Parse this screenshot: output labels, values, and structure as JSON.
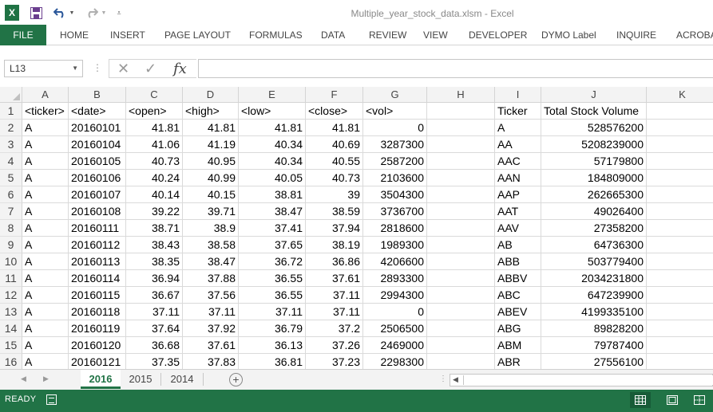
{
  "app": {
    "title": "Multiple_year_stock_data.xlsm - Excel",
    "logo_text": "X"
  },
  "ribbon": {
    "tabs": [
      "FILE",
      "HOME",
      "INSERT",
      "PAGE LAYOUT",
      "FORMULAS",
      "DATA",
      "REVIEW",
      "VIEW",
      "DEVELOPER",
      "DYMO Label",
      "INQUIRE",
      "ACROBA"
    ]
  },
  "formula_bar": {
    "name_box": "L13",
    "cancel_icon": "✕",
    "enter_icon": "✓",
    "fx_label": "fx",
    "content": ""
  },
  "grid": {
    "columns": [
      "A",
      "B",
      "C",
      "D",
      "E",
      "F",
      "G",
      "H",
      "I",
      "J",
      "K"
    ],
    "row_numbers": [
      "1",
      "2",
      "3",
      "4",
      "5",
      "6",
      "7",
      "8",
      "9",
      "10",
      "11",
      "12",
      "13",
      "14",
      "15",
      "16"
    ],
    "rows": [
      [
        "<ticker>",
        "<date>",
        "<open>",
        "<high>",
        "<low>",
        "<close>",
        "<vol>",
        "",
        "Ticker",
        "Total Stock Volume",
        ""
      ],
      [
        "A",
        "20160101",
        "41.81",
        "41.81",
        "41.81",
        "41.81",
        "0",
        "",
        "A",
        "528576200",
        ""
      ],
      [
        "A",
        "20160104",
        "41.06",
        "41.19",
        "40.34",
        "40.69",
        "3287300",
        "",
        "AA",
        "5208239000",
        ""
      ],
      [
        "A",
        "20160105",
        "40.73",
        "40.95",
        "40.34",
        "40.55",
        "2587200",
        "",
        "AAC",
        "57179800",
        ""
      ],
      [
        "A",
        "20160106",
        "40.24",
        "40.99",
        "40.05",
        "40.73",
        "2103600",
        "",
        "AAN",
        "184809000",
        ""
      ],
      [
        "A",
        "20160107",
        "40.14",
        "40.15",
        "38.81",
        "39",
        "3504300",
        "",
        "AAP",
        "262665300",
        ""
      ],
      [
        "A",
        "20160108",
        "39.22",
        "39.71",
        "38.47",
        "38.59",
        "3736700",
        "",
        "AAT",
        "49026400",
        ""
      ],
      [
        "A",
        "20160111",
        "38.71",
        "38.9",
        "37.41",
        "37.94",
        "2818600",
        "",
        "AAV",
        "27358200",
        ""
      ],
      [
        "A",
        "20160112",
        "38.43",
        "38.58",
        "37.65",
        "38.19",
        "1989300",
        "",
        "AB",
        "64736300",
        ""
      ],
      [
        "A",
        "20160113",
        "38.35",
        "38.47",
        "36.72",
        "36.86",
        "4206600",
        "",
        "ABB",
        "503779400",
        ""
      ],
      [
        "A",
        "20160114",
        "36.94",
        "37.88",
        "36.55",
        "37.61",
        "2893300",
        "",
        "ABBV",
        "2034231800",
        ""
      ],
      [
        "A",
        "20160115",
        "36.67",
        "37.56",
        "36.55",
        "37.11",
        "2994300",
        "",
        "ABC",
        "647239900",
        ""
      ],
      [
        "A",
        "20160118",
        "37.11",
        "37.11",
        "37.11",
        "37.11",
        "0",
        "",
        "ABEV",
        "4199335100",
        ""
      ],
      [
        "A",
        "20160119",
        "37.64",
        "37.92",
        "36.79",
        "37.2",
        "2506500",
        "",
        "ABG",
        "89828200",
        ""
      ],
      [
        "A",
        "20160120",
        "36.68",
        "37.61",
        "36.13",
        "37.26",
        "2469000",
        "",
        "ABM",
        "79787400",
        ""
      ],
      [
        "A",
        "20160121",
        "37.35",
        "37.83",
        "36.81",
        "37.23",
        "2298300",
        "",
        "ABR",
        "27556100",
        ""
      ]
    ]
  },
  "sheets": {
    "tabs": [
      "2016",
      "2015",
      "2014"
    ],
    "active": "2016",
    "add_label": "+"
  },
  "status": {
    "text": "READY"
  },
  "colors": {
    "excel_green": "#217346",
    "status_bar": "#217346"
  }
}
